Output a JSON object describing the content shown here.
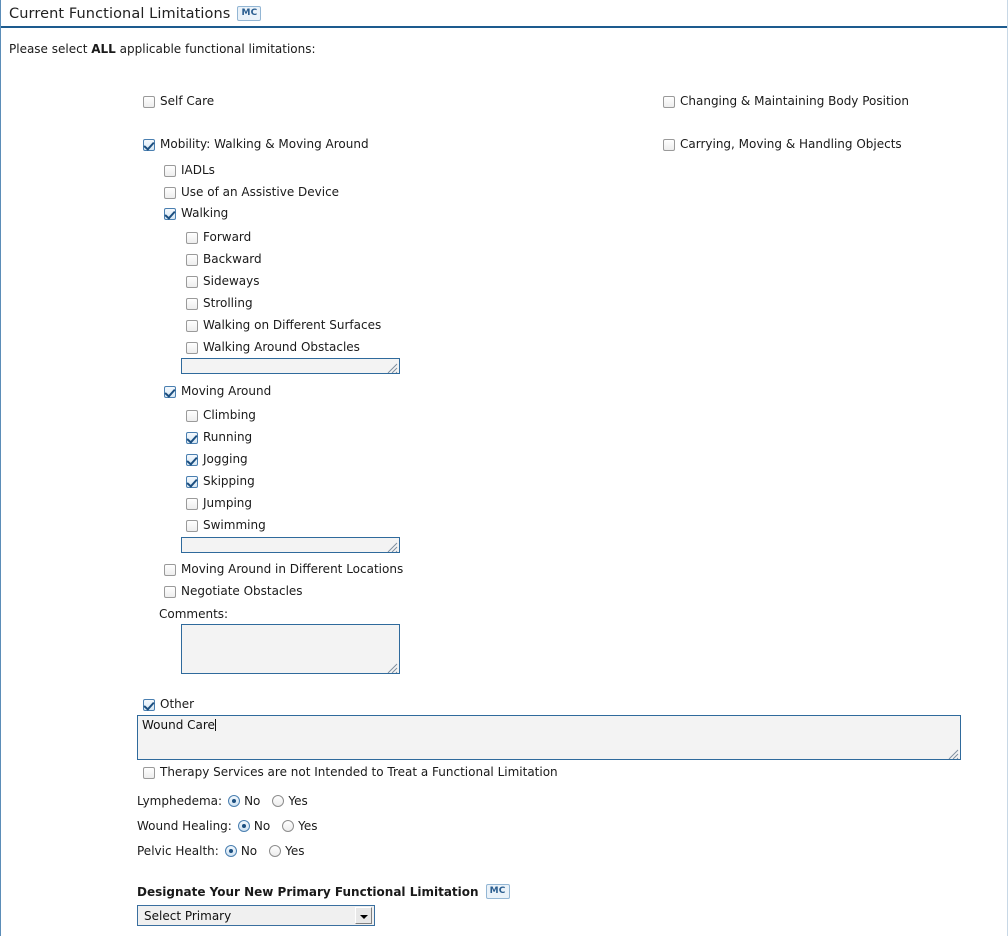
{
  "header": {
    "title": "Current Functional Limitations",
    "badge": "MC"
  },
  "intro": {
    "prefix": "Please select ",
    "emphasis": "ALL",
    "suffix": " applicable functional limitations:"
  },
  "top_level": {
    "left": [
      {
        "label": "Self Care",
        "checked": false
      },
      {
        "label": "Mobility: Walking & Moving Around",
        "checked": true
      }
    ],
    "right": [
      {
        "label": "Changing & Maintaining Body Position",
        "checked": false
      },
      {
        "label": "Carrying, Moving & Handling Objects",
        "checked": false
      }
    ]
  },
  "mobility": {
    "iadls": {
      "label": "IADLs",
      "checked": false
    },
    "assistive_device": {
      "label": "Use of an Assistive Device",
      "checked": false
    },
    "walking": {
      "label": "Walking",
      "checked": true,
      "children": [
        {
          "label": "Forward",
          "checked": false
        },
        {
          "label": "Backward",
          "checked": false
        },
        {
          "label": "Sideways",
          "checked": false
        },
        {
          "label": "Strolling",
          "checked": false
        },
        {
          "label": "Walking on Different Surfaces",
          "checked": false
        },
        {
          "label": "Walking Around Obstacles",
          "checked": false
        }
      ],
      "text_value": ""
    },
    "moving_around": {
      "label": "Moving Around",
      "checked": true,
      "children": [
        {
          "label": "Climbing",
          "checked": false
        },
        {
          "label": "Running",
          "checked": true
        },
        {
          "label": "Jogging",
          "checked": true
        },
        {
          "label": "Skipping",
          "checked": true
        },
        {
          "label": "Jumping",
          "checked": false
        },
        {
          "label": "Swimming",
          "checked": false
        }
      ],
      "text_value": ""
    },
    "different_locations": {
      "label": "Moving Around in Different Locations",
      "checked": false
    },
    "negotiate_obstacles": {
      "label": "Negotiate Obstacles",
      "checked": false
    },
    "comments_label": "Comments:",
    "comments_value": ""
  },
  "other": {
    "label": "Other",
    "checked": true,
    "text_value": "Wound Care"
  },
  "therapy_notice": {
    "label": "Therapy Services are not Intended to Treat a Functional Limitation",
    "checked": false
  },
  "conditions": [
    {
      "label": "Lymphedema:",
      "options": [
        "No",
        "Yes"
      ],
      "selected": "No"
    },
    {
      "label": "Wound Healing:",
      "options": [
        "No",
        "Yes"
      ],
      "selected": "No"
    },
    {
      "label": "Pelvic Health:",
      "options": [
        "No",
        "Yes"
      ],
      "selected": "No"
    }
  ],
  "designate": {
    "title": "Designate Your New Primary Functional Limitation",
    "badge": "MC",
    "select_value": "Select Primary"
  }
}
